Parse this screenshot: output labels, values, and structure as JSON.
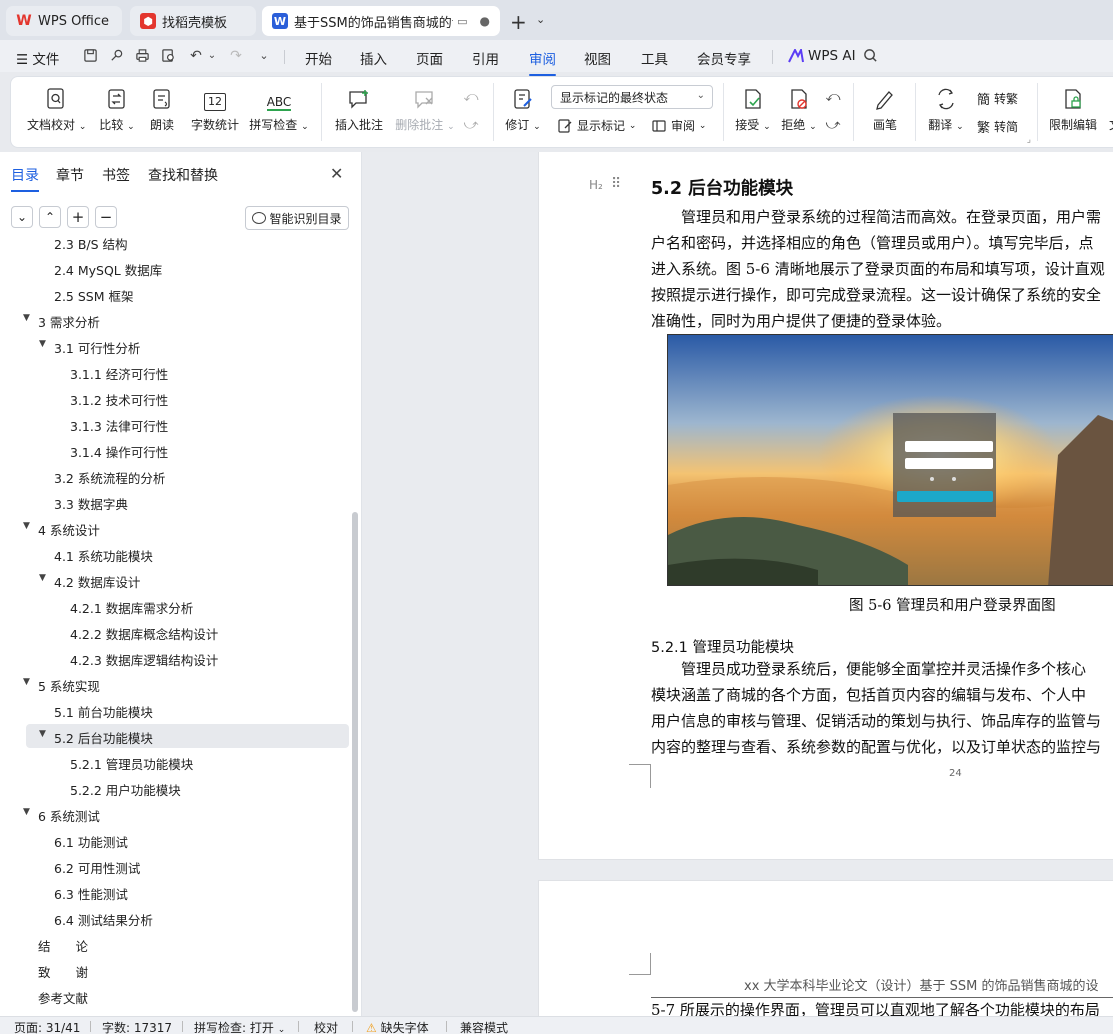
{
  "tabs": [
    {
      "label": "WPS Office",
      "icon": "wps-logo-icon",
      "color": "#e3362e"
    },
    {
      "label": "找稻壳模板",
      "icon": "docer-icon",
      "color": "#e3362e"
    },
    {
      "label": "基于SSM的饰品销售商城的设",
      "icon": "word-doc-icon",
      "color": "#2b5fd9"
    }
  ],
  "menu": {
    "file_label": "文件",
    "items": [
      "开始",
      "插入",
      "页面",
      "引用",
      "审阅",
      "视图",
      "工具",
      "会员专享"
    ],
    "active": "审阅",
    "wps_ai_label": "WPS AI"
  },
  "ribbon": {
    "doc_check": "文档校对",
    "compare": "比较",
    "read_aloud": "朗读",
    "word_count": "字数统计",
    "spell_check": "拼写检查",
    "insert_comment": "插入批注",
    "delete_comment": "删除批注",
    "track_changes": "修订",
    "display_select": "显示标记的最终状态",
    "show_markup": "显示标记",
    "review_pane": "审阅",
    "accept": "接受",
    "reject": "拒绝",
    "ink": "画笔",
    "translate": "翻译",
    "to_traditional": "转繁",
    "to_simplified": "转简",
    "restrict_edit": "限制编辑",
    "count_icon_text": "12",
    "abc_text": "ABC"
  },
  "panel": {
    "tabs": [
      "目录",
      "章节",
      "书签",
      "查找和替换"
    ],
    "smart_button": "智能识别目录",
    "toc": [
      {
        "label": "2.3 B/S 结构",
        "level": 2,
        "arrow": ""
      },
      {
        "label": "2.4 MySQL 数据库",
        "level": 2,
        "arrow": ""
      },
      {
        "label": "2.5 SSM 框架",
        "level": 2,
        "arrow": ""
      },
      {
        "label": "3 需求分析",
        "level": 1,
        "arrow": "▼"
      },
      {
        "label": "3.1  可行性分析",
        "level": 2,
        "arrow": "▼"
      },
      {
        "label": "3.1.1  经济可行性",
        "level": 3,
        "arrow": ""
      },
      {
        "label": "3.1.2  技术可行性",
        "level": 3,
        "arrow": ""
      },
      {
        "label": "3.1.3  法律可行性",
        "level": 3,
        "arrow": ""
      },
      {
        "label": "3.1.4  操作可行性",
        "level": 3,
        "arrow": ""
      },
      {
        "label": "3.2 系统流程的分析",
        "level": 2,
        "arrow": ""
      },
      {
        "label": "3.3  数据字典",
        "level": 2,
        "arrow": ""
      },
      {
        "label": "4 系统设计",
        "level": 1,
        "arrow": "▼"
      },
      {
        "label": "4.1 系统功能模块",
        "level": 2,
        "arrow": ""
      },
      {
        "label": "4.2  数据库设计",
        "level": 2,
        "arrow": "▼"
      },
      {
        "label": "4.2.1  数据库需求分析",
        "level": 3,
        "arrow": ""
      },
      {
        "label": "4.2.2  数据库概念结构设计",
        "level": 3,
        "arrow": ""
      },
      {
        "label": "4.2.3  数据库逻辑结构设计",
        "level": 3,
        "arrow": ""
      },
      {
        "label": "5  系统实现",
        "level": 1,
        "arrow": "▼"
      },
      {
        "label": "5.1  前台功能模块",
        "level": 2,
        "arrow": ""
      },
      {
        "label": "5.2 后台功能模块",
        "level": 2,
        "arrow": "▼",
        "selected": true
      },
      {
        "label": "5.2.1 管理员功能模块",
        "level": 3,
        "arrow": ""
      },
      {
        "label": "5.2.2 用户功能模块",
        "level": 3,
        "arrow": ""
      },
      {
        "label": "6  系统测试",
        "level": 1,
        "arrow": "▼"
      },
      {
        "label": "6.1  功能测试",
        "level": 2,
        "arrow": ""
      },
      {
        "label": "6.2  可用性测试",
        "level": 2,
        "arrow": ""
      },
      {
        "label": "6.3  性能测试",
        "level": 2,
        "arrow": ""
      },
      {
        "label": "6.4  测试结果分析",
        "level": 2,
        "arrow": ""
      },
      {
        "label": "结　　论",
        "level": 1,
        "arrow": ""
      },
      {
        "label": "致　　谢",
        "level": 1,
        "arrow": ""
      },
      {
        "label": "参考文献",
        "level": 1,
        "arrow": ""
      }
    ]
  },
  "document": {
    "heading_tag": "H₂",
    "heading": "5.2 后台功能模块",
    "para1": [
      "　　管理员和用户登录系统的过程简洁而高效。在登录页面，用户需",
      "户名和密码，并选择相应的角色（管理员或用户）。填写完毕后，点",
      "进入系统。图 5-6 清晰地展示了登录页面的布局和填写项，设计直观",
      "按照提示进行操作，即可完成登录流程。这一设计确保了系统的安全",
      "准确性，同时为用户提供了便捷的登录体验。"
    ],
    "figure_caption": "图 5-6 管理员和用户登录界面图",
    "subheading": "5.2.1 管理员功能模块",
    "para2": [
      "　　管理员成功登录系统后，便能够全面掌控并灵活操作多个核心",
      "模块涵盖了商城的各个方面，包括首页内容的编辑与发布、个人中",
      "用户信息的审核与管理、促销活动的策划与执行、饰品库存的监管与",
      "内容的整理与查看、系统参数的配置与优化，以及订单状态的监控与"
    ],
    "page_number": "24",
    "running_header": "xx 大学本科毕业论文（设计）基于 SSM 的饰品销售商城的设",
    "page2_text": "5-7 所展示的操作界面，管理员可以直观地了解各个功能模块的布局"
  },
  "statusbar": {
    "page": "页面: 31/41",
    "words": "字数: 17317",
    "spell": "拼写检查: 打开",
    "proof": "校对",
    "missing_font": "缺失字体",
    "compat": "兼容模式"
  },
  "colors": {
    "accent": "#1d5fe0",
    "warning": "#f0a020"
  }
}
